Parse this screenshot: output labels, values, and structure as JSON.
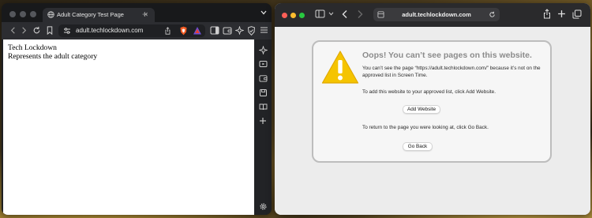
{
  "left_browser": {
    "tab_title": "Adult Category Test Page",
    "tab_close": "✕",
    "new_tab": "+",
    "url": "adult.techlockdown.com",
    "page_lines": [
      "Tech Lockdown",
      "Represents the adult category"
    ]
  },
  "right_browser": {
    "url": "adult.techlockdown.com",
    "error": {
      "title": "Oops! You can’t see pages on this website.",
      "message": "You can’t see the page “https://adult.techlockdown.com/” because it’s not on the approved list in Screen Time.",
      "add_instruction": "To add this website to your approved list, click Add Website.",
      "add_button": "Add Website",
      "back_instruction": "To return to the page you were looking at, click Go Back.",
      "back_button": "Go Back"
    }
  },
  "colors": {
    "brave_accent": "#f25a22",
    "warning_yellow": "#f5c400",
    "traffic_red": "#fe5f57",
    "traffic_yellow": "#febc2e",
    "traffic_green": "#28c840"
  },
  "icons": {
    "left_toolbar": [
      "back-icon",
      "forward-icon",
      "reload-icon",
      "bookmark-icon",
      "site-settings-icon",
      "share-icon",
      "brave-shields-icon",
      "brave-rewards-icon",
      "sidebar-toggle-icon",
      "wallet-icon",
      "leo-icon",
      "vpn-icon",
      "menu-icon"
    ],
    "left_sidebar": [
      "leo-ai-icon",
      "playlist-icon",
      "wallet-icon",
      "bookmarks-icon",
      "reading-list-icon",
      "add-panel-icon",
      "settings-icon"
    ],
    "right_toolbar": [
      "sidebar-icon",
      "chevron-down-icon",
      "back-icon",
      "forward-icon",
      "page-icon",
      "reload-icon",
      "share-icon",
      "new-tab-icon",
      "tab-overview-icon"
    ]
  }
}
